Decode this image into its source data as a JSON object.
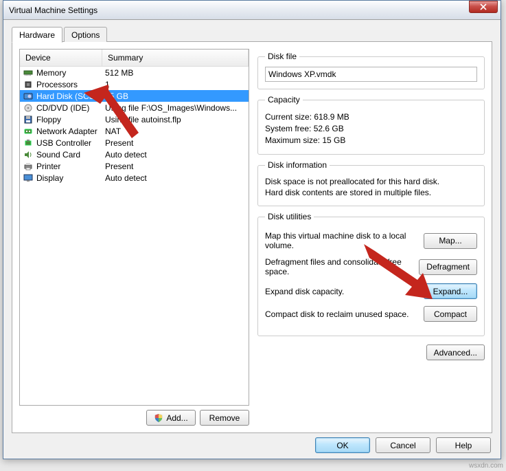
{
  "window": {
    "title": "Virtual Machine Settings"
  },
  "tabs": {
    "hardware": "Hardware",
    "options": "Options"
  },
  "table": {
    "head_device": "Device",
    "head_summary": "Summary",
    "rows": [
      {
        "icon": "memory",
        "name": "Memory",
        "summary": "512 MB"
      },
      {
        "icon": "cpu",
        "name": "Processors",
        "summary": "1"
      },
      {
        "icon": "disk",
        "name": "Hard Disk (SCSI)",
        "summary": "15 GB",
        "selected": true
      },
      {
        "icon": "cd",
        "name": "CD/DVD (IDE)",
        "summary": "Using file F:\\OS_Images\\Windows..."
      },
      {
        "icon": "floppy",
        "name": "Floppy",
        "summary": "Using file autoinst.flp"
      },
      {
        "icon": "net",
        "name": "Network Adapter",
        "summary": "NAT"
      },
      {
        "icon": "usb",
        "name": "USB Controller",
        "summary": "Present"
      },
      {
        "icon": "sound",
        "name": "Sound Card",
        "summary": "Auto detect"
      },
      {
        "icon": "printer",
        "name": "Printer",
        "summary": "Present"
      },
      {
        "icon": "display",
        "name": "Display",
        "summary": "Auto detect"
      }
    ]
  },
  "buttons": {
    "add": "Add...",
    "remove": "Remove",
    "ok": "OK",
    "cancel": "Cancel",
    "help": "Help",
    "advanced": "Advanced..."
  },
  "diskfile": {
    "legend": "Disk file",
    "value": "Windows XP.vmdk"
  },
  "capacity": {
    "legend": "Capacity",
    "current_label": "Current size:",
    "current_value": "618.9 MB",
    "free_label": "System free:",
    "free_value": "52.6 GB",
    "max_label": "Maximum size:",
    "max_value": "15 GB"
  },
  "diskinfo": {
    "legend": "Disk information",
    "line1": "Disk space is not preallocated for this hard disk.",
    "line2": "Hard disk contents are stored in multiple files."
  },
  "utilities": {
    "legend": "Disk utilities",
    "map_desc": "Map this virtual machine disk to a local volume.",
    "map_btn": "Map...",
    "defrag_desc": "Defragment files and consolidate free space.",
    "defrag_btn": "Defragment",
    "expand_desc": "Expand disk capacity.",
    "expand_btn": "Expand...",
    "compact_desc": "Compact disk to reclaim unused space.",
    "compact_btn": "Compact"
  },
  "watermark": "wsxdn.com"
}
